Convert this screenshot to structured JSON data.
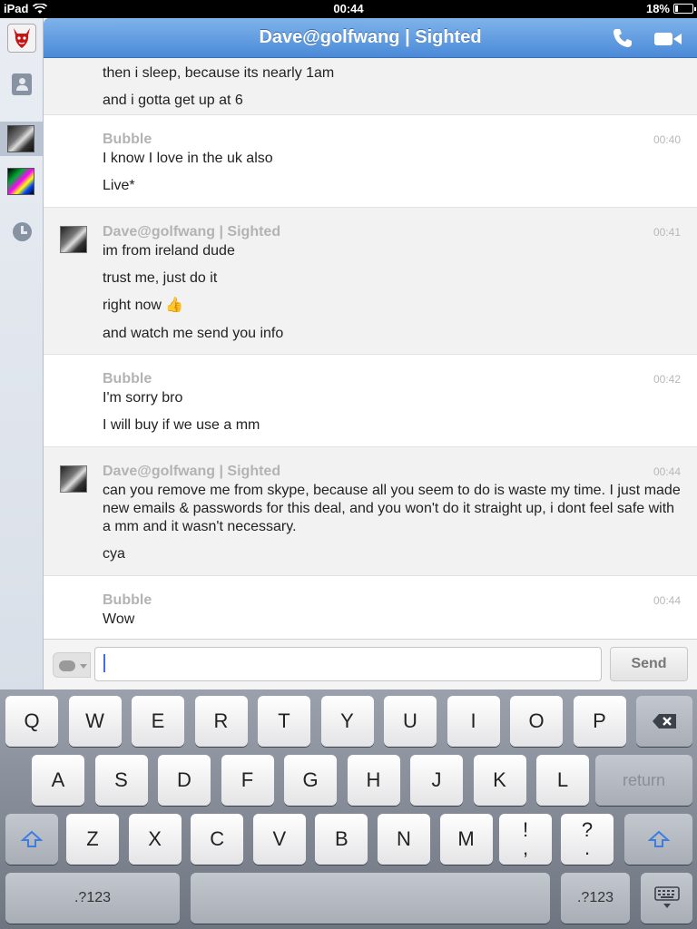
{
  "status_bar": {
    "device": "iPad",
    "time": "00:44",
    "battery": "18%",
    "battery_level": 0.18
  },
  "chat": {
    "title": "Dave@golfwang | Sighted",
    "messages": [
      {
        "sender": "",
        "time": "",
        "has_avatar": false,
        "lines": [
          "then i sleep, because its nearly 1am",
          "and i gotta get up at 6"
        ]
      },
      {
        "sender": "Bubble",
        "time": "00:40",
        "has_avatar": false,
        "lines": [
          "I know I love in the uk also",
          "Live*"
        ]
      },
      {
        "sender": "Dave@golfwang | Sighted",
        "time": "00:41",
        "has_avatar": true,
        "lines": [
          "im from ireland dude",
          "trust me, just do it",
          "right now 👍",
          "and watch me send you info"
        ]
      },
      {
        "sender": "Bubble",
        "time": "00:42",
        "has_avatar": false,
        "lines": [
          "I'm sorry bro",
          "I will buy if we use a mm"
        ]
      },
      {
        "sender": "Dave@golfwang | Sighted",
        "time": "00:44",
        "has_avatar": true,
        "lines": [
          "can you remove me from skype, because all you seem to do is waste my time. I just made new emails & passwords for this deal, and you won't do it straight up, i dont feel safe with a mm and it wasn't necessary.",
          "cya"
        ]
      },
      {
        "sender": "Bubble",
        "time": "00:44",
        "has_avatar": false,
        "lines": [
          "Wow"
        ]
      }
    ]
  },
  "composer": {
    "input_value": "",
    "send_label": "Send"
  },
  "keyboard": {
    "row1": [
      "Q",
      "W",
      "E",
      "R",
      "T",
      "Y",
      "U",
      "I",
      "O",
      "P"
    ],
    "row2": [
      "A",
      "S",
      "D",
      "F",
      "G",
      "H",
      "J",
      "K",
      "L"
    ],
    "return_label": "return",
    "row3": [
      "Z",
      "X",
      "C",
      "V",
      "B",
      "N",
      "M"
    ],
    "punct1": [
      "!",
      ","
    ],
    "punct2": [
      "?",
      "."
    ],
    "numbers_label": ".?123"
  },
  "icons": {
    "wifi": "wifi-icon",
    "battery": "battery-icon",
    "call": "phone-icon",
    "video": "video-camera-icon",
    "contacts": "contacts-book-icon",
    "recent": "clock-icon",
    "backspace": "backspace-icon",
    "shift": "shift-arrow-icon",
    "hide_keyboard": "keyboard-hide-icon"
  },
  "colors": {
    "titlebar": "#4b8ad8",
    "sender": "#b3b3b3",
    "caret": "#3f6fe0"
  }
}
